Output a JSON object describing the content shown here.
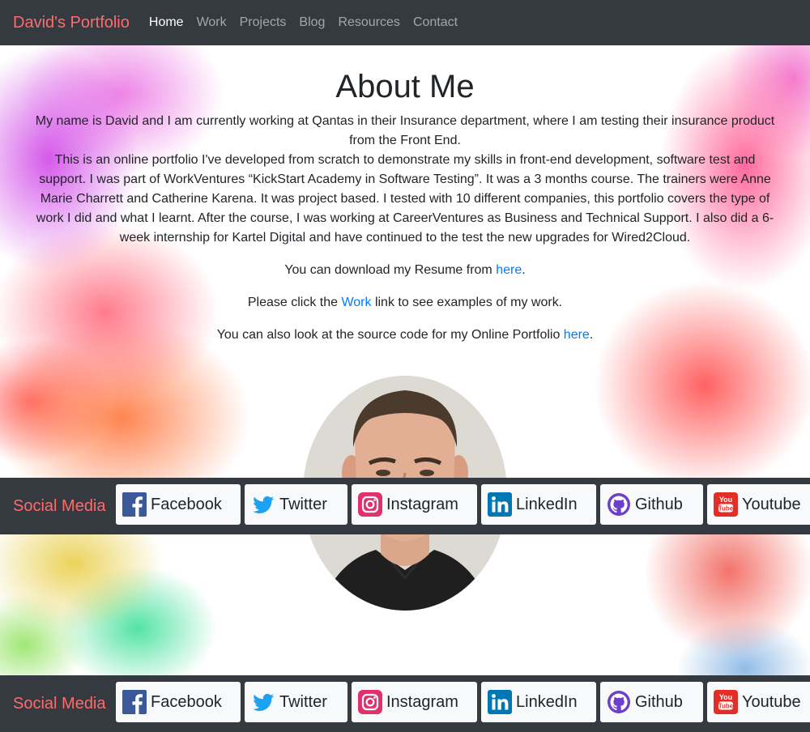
{
  "nav": {
    "brand": "David's Portfolio",
    "links": [
      "Home",
      "Work",
      "Projects",
      "Blog",
      "Resources",
      "Contact"
    ],
    "active": "Home"
  },
  "about": {
    "title": "About Me",
    "intro_line1": "My name is David and I am currently working at Qantas in their Insurance department, where I am testing their insurance product from the Front End.",
    "intro_line2": "This is an online portfolio I've developed from scratch to demonstrate my skills in front-end development, software test and support. I was part of WorkVentures “KickStart Academy in Software Testing”. It was a 3 months course. The trainers were Anne Marie Charrett and Catherine Karena. It was project based. I tested with 10 different companies, this portfolio covers the type of work I did and what I learnt. After the course, I was working at CareerVentures as Business and Technical Support. I also did a 6-week internship for Kartel Digital and have continued to the test the new upgrades for Wired2Cloud.",
    "resume_prefix": "You can download my Resume from ",
    "resume_link": "here",
    "resume_suffix": ".",
    "work_prefix": "Please click the ",
    "work_link": "Work",
    "work_suffix": " link to see examples of my work.",
    "source_prefix": "You can also look at the source code for my Online Portfolio ",
    "source_link": "here",
    "source_suffix": "."
  },
  "social": {
    "title": "Social Media",
    "buttons": [
      {
        "label": "Facebook",
        "icon": "facebook-icon",
        "color": "#3b5998"
      },
      {
        "label": "Twitter",
        "icon": "twitter-icon",
        "color": "#1da1f2"
      },
      {
        "label": "Instagram",
        "icon": "instagram-icon",
        "color": "#e1306c"
      },
      {
        "label": "LinkedIn",
        "icon": "linkedin-icon",
        "color": "#0077b5"
      },
      {
        "label": "Github",
        "icon": "github-icon",
        "color": "#6e40c9"
      },
      {
        "label": "Youtube",
        "icon": "youtube-icon",
        "color": "#ff0000"
      }
    ]
  },
  "colors": {
    "navbar_bg": "#343a40",
    "brand": "#ff6b6b",
    "link": "#007bff"
  }
}
